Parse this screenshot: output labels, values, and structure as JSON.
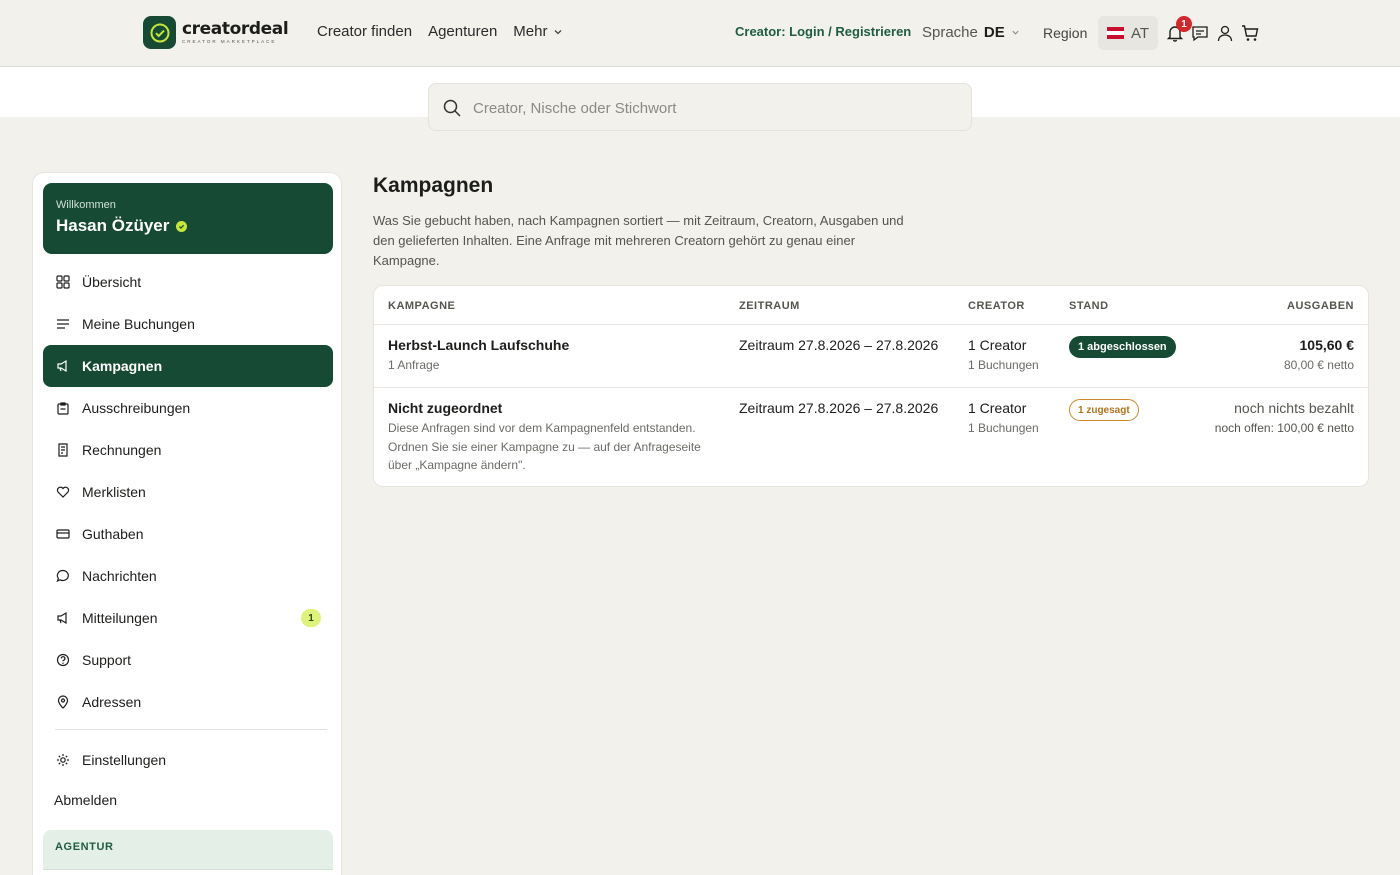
{
  "header": {
    "logo_word": "creatordeal",
    "logo_sub": "CREATOR MARKETPLACE",
    "nav": [
      "Creator finden",
      "Agenturen",
      "Mehr"
    ],
    "login_link": "Creator: Login / Registrieren",
    "language_label": "Sprache",
    "language_value": "DE",
    "region_label": "Region",
    "region_value": "AT",
    "notification_count": "1"
  },
  "search": {
    "placeholder": "Creator, Nische oder Stichwort"
  },
  "sidebar": {
    "welcome": "Willkommen",
    "user_name": "Hasan Özüyer",
    "items": [
      {
        "label": "Übersicht",
        "icon": "grid-icon"
      },
      {
        "label": "Meine Buchungen",
        "icon": "list-icon"
      },
      {
        "label": "Kampagnen",
        "icon": "megaphone-icon",
        "active": true
      },
      {
        "label": "Ausschreibungen",
        "icon": "clipboard-icon"
      },
      {
        "label": "Rechnungen",
        "icon": "receipt-icon"
      },
      {
        "label": "Merklisten",
        "icon": "heart-icon"
      },
      {
        "label": "Guthaben",
        "icon": "card-icon"
      },
      {
        "label": "Nachrichten",
        "icon": "chat-icon"
      },
      {
        "label": "Mitteilungen",
        "icon": "megaphone-icon",
        "badge": "1"
      },
      {
        "label": "Support",
        "icon": "help-icon"
      },
      {
        "label": "Adressen",
        "icon": "pin-icon"
      }
    ],
    "settings": "Einstellungen",
    "logout": "Abmelden",
    "section_title": "AGENTUR"
  },
  "main": {
    "title": "Kampagnen",
    "description": "Was Sie gebucht haben, nach Kampagnen sortiert — mit Zeitraum, Creatorn, Ausgaben und den gelieferten Inhalten. Eine Anfrage mit mehreren Creatorn gehört zu genau einer Kampagne.",
    "table": {
      "columns": [
        "KAMPAGNE",
        "ZEITRAUM",
        "CREATOR",
        "STAND",
        "AUSGABEN"
      ],
      "rows": [
        {
          "name": "Herbst-Launch Laufschuhe",
          "sub": "1 Anfrage",
          "period": "Zeitraum 27.8.2026 – 27.8.2026",
          "creators": "1 Creator",
          "bookings": "1 Buchungen",
          "status": "1 abgeschlossen",
          "amount": "105,60 €",
          "amount_sub": "80,00 € netto"
        },
        {
          "name": "Nicht zugeordnet",
          "sub": "Diese Anfragen sind vor dem Kampagnenfeld entstanden. Ordnen Sie sie einer Kampagne zu — auf der Anfrageseite über „Kampagne ändern\".",
          "period": "Zeitraum 27.8.2026 – 27.8.2026",
          "creators": "1 Creator",
          "bookings": "1 Buchungen",
          "status": "1 zugesagt",
          "amount": "noch nichts bezahlt",
          "amount_sub": "noch offen: 100,00 € netto"
        }
      ]
    }
  },
  "colors": {
    "brand": "#174a35",
    "accent": "#c8e63a",
    "background": "#f2f1ec",
    "warning": "#c98a2b"
  }
}
